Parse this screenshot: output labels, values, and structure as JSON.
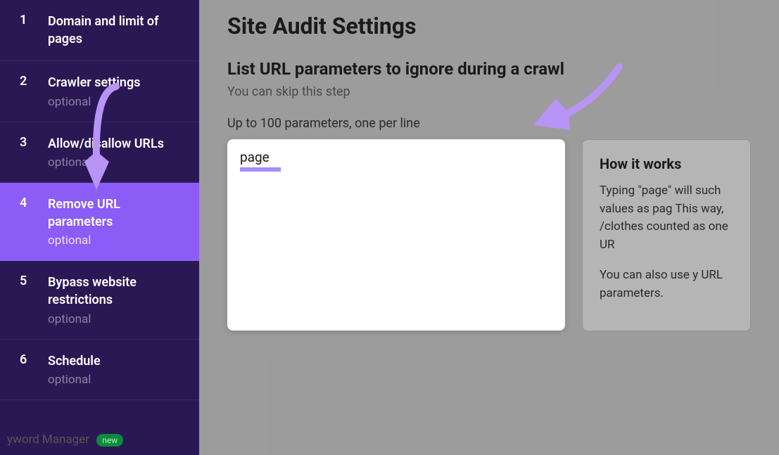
{
  "sidebar": {
    "steps": [
      {
        "num": "1",
        "title": "Domain and limit of pages",
        "optional": ""
      },
      {
        "num": "2",
        "title": "Crawler settings",
        "optional": "optional"
      },
      {
        "num": "3",
        "title": "Allow/disallow URLs",
        "optional": "optional"
      },
      {
        "num": "4",
        "title": "Remove URL parameters",
        "optional": "optional"
      },
      {
        "num": "5",
        "title": "Bypass website restrictions",
        "optional": "optional"
      },
      {
        "num": "6",
        "title": "Schedule",
        "optional": "optional"
      }
    ]
  },
  "footer": {
    "text": "yword Manager",
    "badge": "new"
  },
  "main": {
    "title": "Site Audit Settings",
    "section_title": "List URL parameters to ignore during a crawl",
    "subtitle": "You can skip this step",
    "hint": "Up to 100 parameters, one per line",
    "textarea_value": "page",
    "info": {
      "title": "How it works",
      "p1": "Typing \"page\" will such values as pag This way, /clothes counted as one UR",
      "p2": "You can also use y URL parameters."
    }
  }
}
